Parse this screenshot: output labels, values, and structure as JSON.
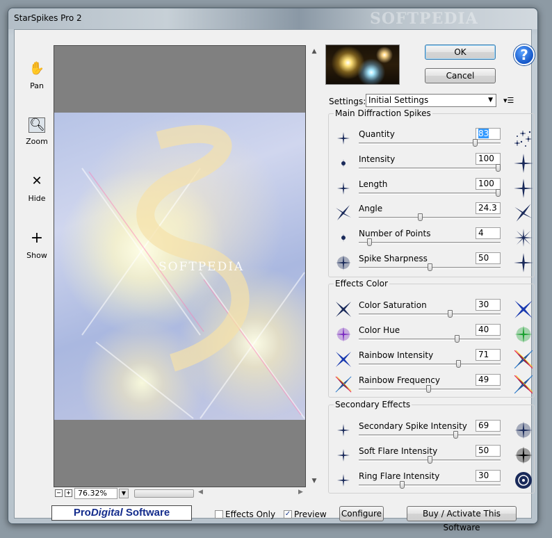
{
  "window": {
    "title": "StarSpikes Pro 2",
    "title_watermark": "SOFTPEDIA"
  },
  "tools": [
    {
      "label": "Pan",
      "icon": "hand-icon"
    },
    {
      "label": "Zoom",
      "icon": "magnifier-icon"
    },
    {
      "label": "Hide",
      "icon": "x-icon"
    },
    {
      "label": "Show",
      "icon": "plus-icon"
    }
  ],
  "preview": {
    "watermark": "SOFTPEDIA",
    "zoom_value": "76.32%"
  },
  "buttons": {
    "ok": "OK",
    "cancel": "Cancel",
    "help": "?",
    "configure": "Configure",
    "buy": "Buy / Activate This Software"
  },
  "settings": {
    "label": "Settings:",
    "selected": "Initial Settings"
  },
  "groups": {
    "main": {
      "title": "Main Diffraction Spikes",
      "rows": [
        {
          "name": "Quantity",
          "value": "83",
          "level": 0.83
        },
        {
          "name": "Intensity",
          "value": "100",
          "level": 1.0
        },
        {
          "name": "Length",
          "value": "100",
          "level": 1.0
        },
        {
          "name": "Angle",
          "value": "24.3",
          "level": 0.43
        },
        {
          "name": "Number of Points",
          "value": "4",
          "level": 0.06
        },
        {
          "name": "Spike Sharpness",
          "value": "50",
          "level": 0.5
        }
      ]
    },
    "color": {
      "title": "Effects Color",
      "rows": [
        {
          "name": "Color Saturation",
          "value": "30",
          "level": 0.65
        },
        {
          "name": "Color Hue",
          "value": "40",
          "level": 0.7
        },
        {
          "name": "Rainbow Intensity",
          "value": "71",
          "level": 0.71
        },
        {
          "name": "Rainbow Frequency",
          "value": "49",
          "level": 0.49
        }
      ]
    },
    "secondary": {
      "title": "Secondary Effects",
      "rows": [
        {
          "name": "Secondary Spike Intensity",
          "value": "69",
          "level": 0.69
        },
        {
          "name": "Soft Flare Intensity",
          "value": "50",
          "level": 0.5
        },
        {
          "name": "Ring Flare Intensity",
          "value": "30",
          "level": 0.3
        }
      ]
    }
  },
  "footer": {
    "logo_a": "Pro",
    "logo_b": "Digital",
    "logo_c": " Software",
    "effects_only_label": "Effects Only",
    "effects_only_checked": false,
    "preview_label": "Preview",
    "preview_checked": true
  }
}
